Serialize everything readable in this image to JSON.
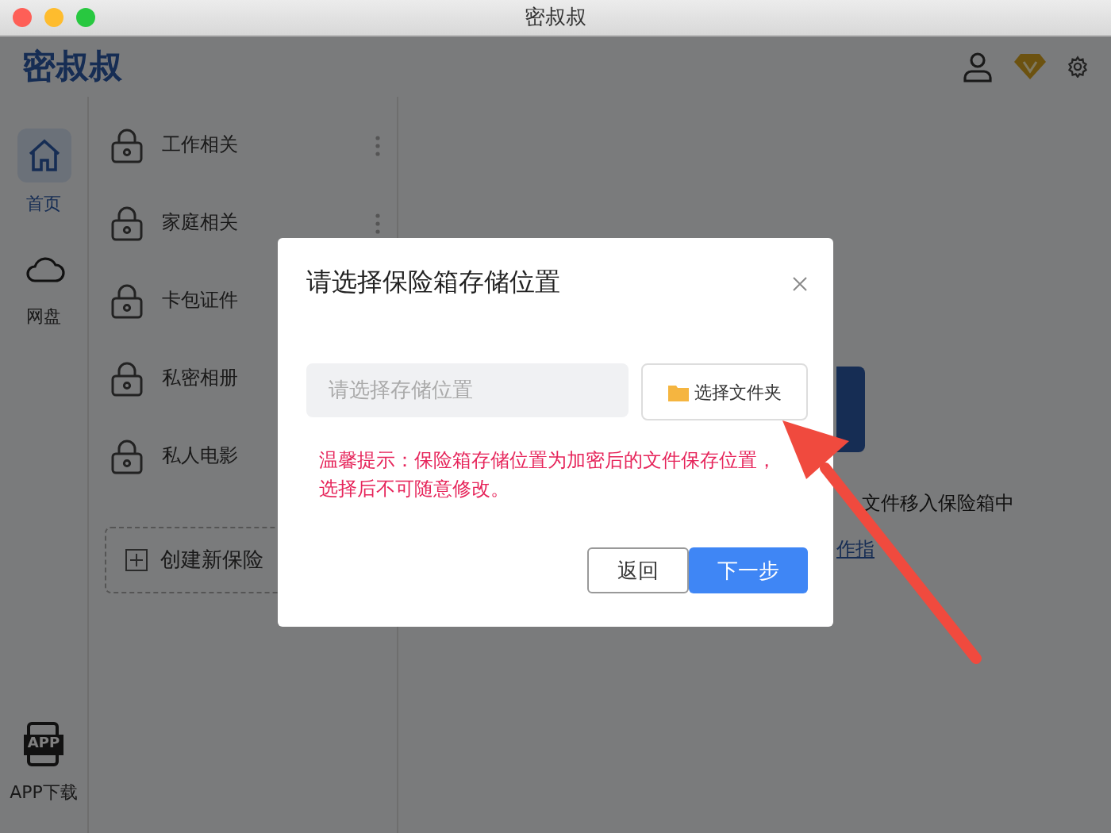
{
  "window": {
    "title": "密叔叔"
  },
  "header": {
    "logo": "密叔叔"
  },
  "nav": [
    {
      "kind": "home",
      "label": "首页",
      "selected": true
    },
    {
      "kind": "cloud",
      "label": "网盘",
      "selected": false
    },
    {
      "kind": "app",
      "badge": "APP",
      "label": "APP下载",
      "selected": false
    }
  ],
  "vaults": [
    {
      "name": "工作相关",
      "menu": true
    },
    {
      "name": "家庭相关",
      "menu": true
    },
    {
      "name": "卡包证件",
      "menu": false
    },
    {
      "name": "私密相册",
      "menu": false
    },
    {
      "name": "私人电影",
      "menu": false
    }
  ],
  "create_button": "创建新保险",
  "content": {
    "text": "文件移入保险箱中",
    "link": "作指"
  },
  "dialog": {
    "title": "请选择保险箱存储位置",
    "placeholder": "请选择存储位置",
    "choose_button": "选择文件夹",
    "hint": "温馨提示：保险箱存储位置为加密后的文件保存位置，选择后不可随意修改。",
    "back_button": "返回",
    "next_button": "下一步"
  }
}
